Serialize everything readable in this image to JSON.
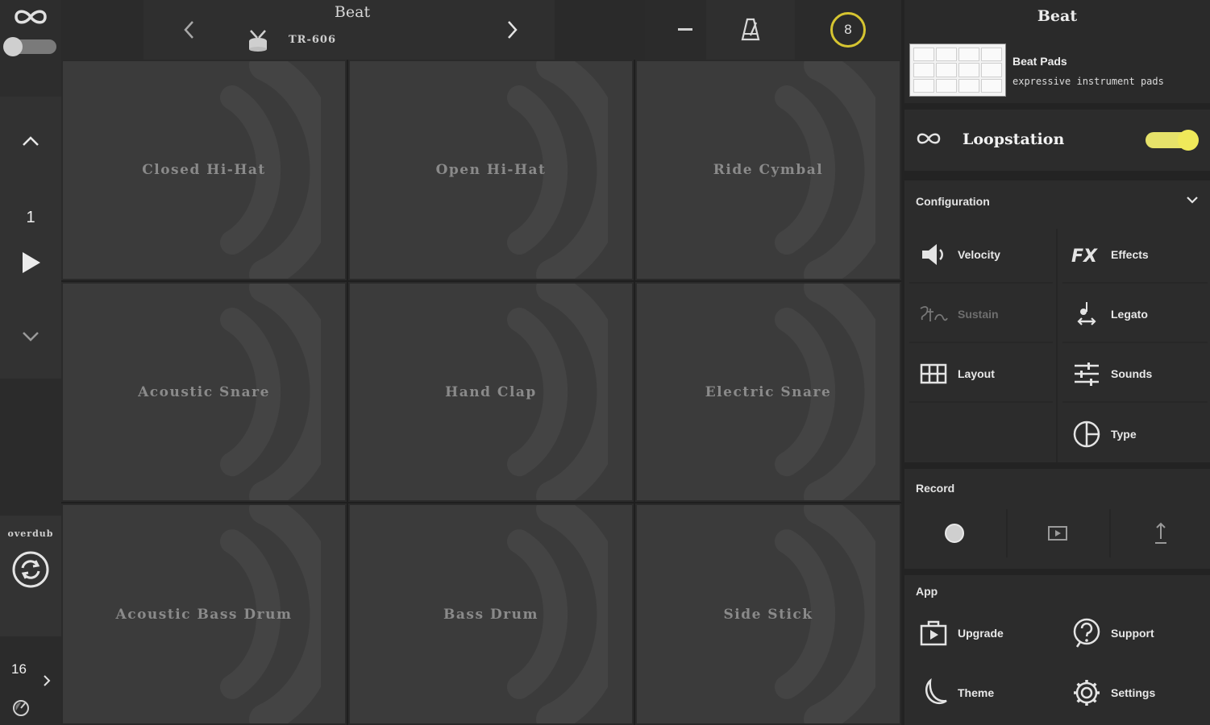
{
  "left_rail": {
    "track_number": "1",
    "overdub_label": "overdub",
    "bar_count": "16"
  },
  "top_bar": {
    "kit_title": "Beat",
    "kit_name": "TR-606",
    "count_in": "8"
  },
  "pads": [
    "Closed Hi-Hat",
    "Open Hi-Hat",
    "Ride Cymbal",
    "Acoustic Snare",
    "Hand Clap",
    "Electric Snare",
    "Acoustic Bass Drum",
    "Bass Drum",
    "Side Stick"
  ],
  "right_panel": {
    "header": "Beat",
    "layout_name": "Beat Pads",
    "layout_desc": "expressive instrument pads",
    "loopstation_label": "Loopstation",
    "loopstation_on": true,
    "configuration": {
      "title": "Configuration",
      "items": [
        {
          "label": "Velocity",
          "icon": "speaker-icon"
        },
        {
          "label": "Effects",
          "icon": "fx-icon"
        },
        {
          "label": "Sustain",
          "icon": "sustain-icon",
          "disabled": true
        },
        {
          "label": "Legato",
          "icon": "legato-icon"
        },
        {
          "label": "Layout",
          "icon": "grid-icon"
        },
        {
          "label": "Sounds",
          "icon": "sliders-icon"
        },
        {
          "label": "Type",
          "icon": "pie-icon"
        }
      ]
    },
    "record": {
      "title": "Record"
    },
    "app": {
      "title": "App",
      "items": [
        {
          "label": "Upgrade",
          "icon": "upgrade-icon"
        },
        {
          "label": "Support",
          "icon": "help-icon"
        },
        {
          "label": "Theme",
          "icon": "moon-icon"
        },
        {
          "label": "Settings",
          "icon": "gear-icon"
        }
      ]
    }
  },
  "colors": {
    "accent_yellow": "#e6e26a",
    "count_ring": "#d6c531",
    "pad_bg": "#3b3b3b",
    "panel_bg": "#2c2c2c"
  }
}
